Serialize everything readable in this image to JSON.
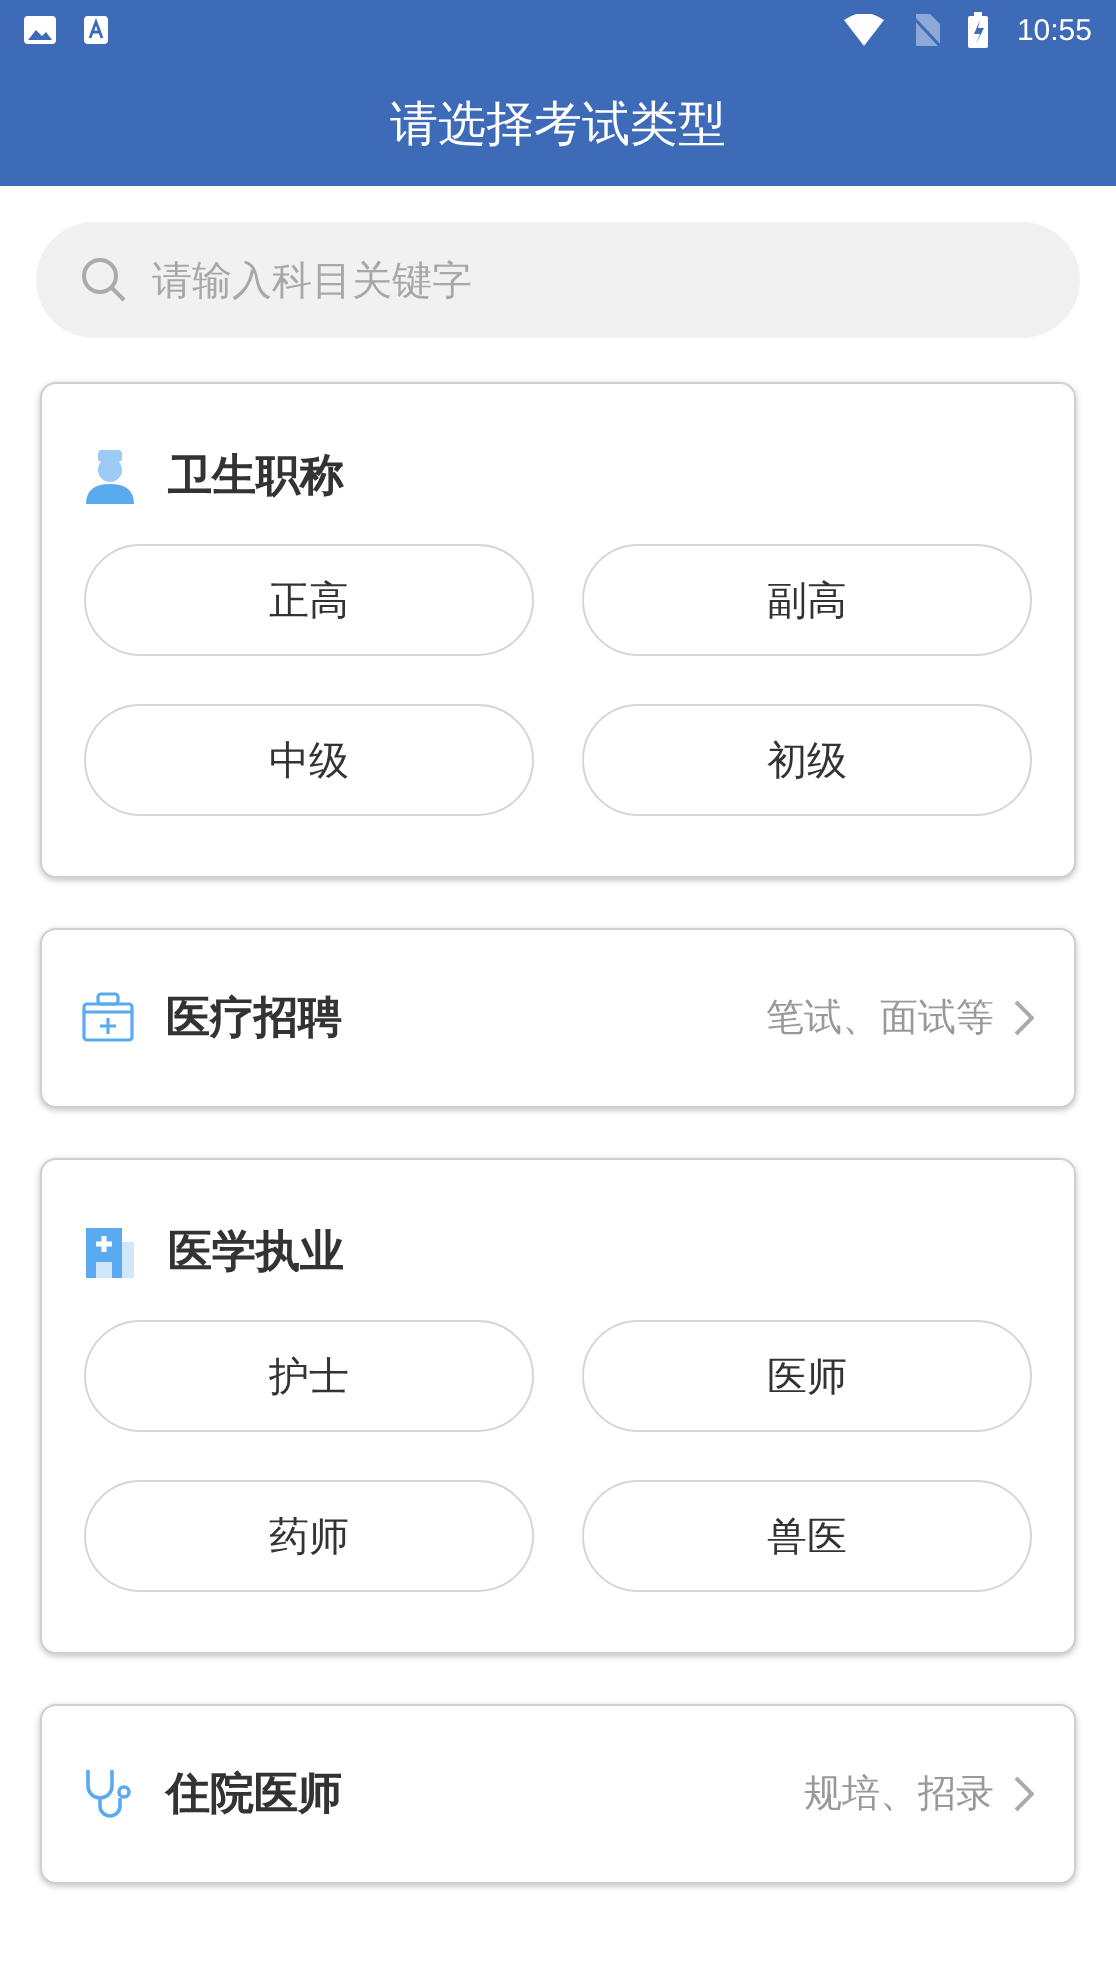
{
  "status_bar": {
    "time": "10:55"
  },
  "header": {
    "title": "请选择考试类型"
  },
  "search": {
    "placeholder": "请输入科目关键字"
  },
  "sections": [
    {
      "kind": "grid",
      "title": "卫生职称",
      "options": [
        "正高",
        "副高",
        "中级",
        "初级"
      ]
    },
    {
      "kind": "link",
      "title": "医疗招聘",
      "hint": "笔试、面试等"
    },
    {
      "kind": "grid",
      "title": "医学执业",
      "options": [
        "护士",
        "医师",
        "药师",
        "兽医"
      ]
    },
    {
      "kind": "link",
      "title": "住院医师",
      "hint": "规培、招录"
    }
  ]
}
